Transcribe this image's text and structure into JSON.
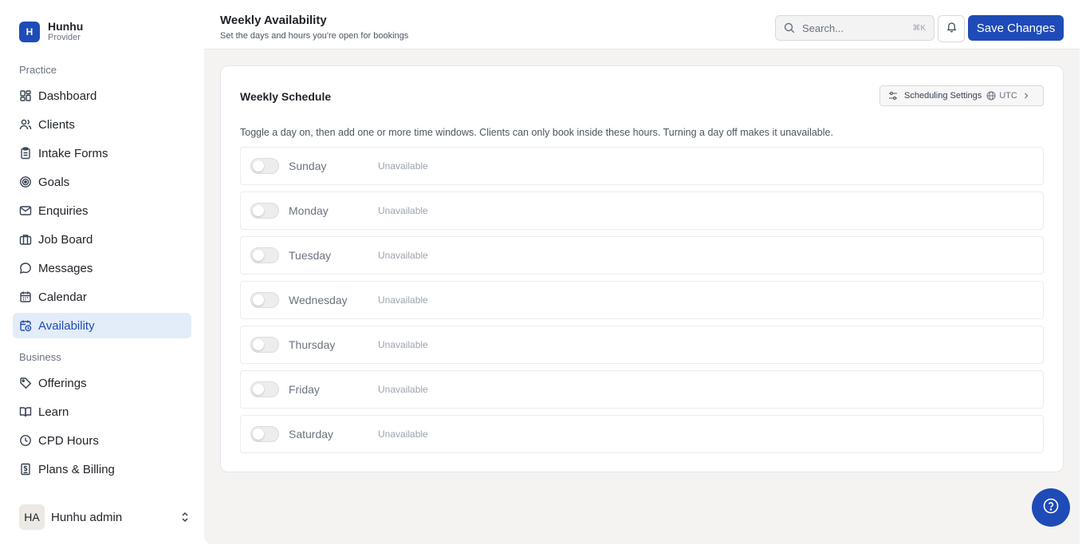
{
  "brand": {
    "logo_letter": "H",
    "name": "Hunhu",
    "subtitle": "Provider"
  },
  "sidebar": {
    "section_practice": "Practice",
    "practice_items": [
      {
        "label": "Dashboard",
        "icon": "dashboard-icon"
      },
      {
        "label": "Clients",
        "icon": "users-icon"
      },
      {
        "label": "Intake Forms",
        "icon": "clipboard-icon"
      },
      {
        "label": "Goals",
        "icon": "target-icon"
      },
      {
        "label": "Enquiries",
        "icon": "mail-icon"
      },
      {
        "label": "Job Board",
        "icon": "briefcase-icon"
      },
      {
        "label": "Messages",
        "icon": "chat-icon"
      },
      {
        "label": "Calendar",
        "icon": "calendar-icon"
      },
      {
        "label": "Availability",
        "icon": "calendar-clock-icon",
        "active": true
      }
    ],
    "section_business": "Business",
    "business_items": [
      {
        "label": "Offerings",
        "icon": "tag-icon"
      },
      {
        "label": "Learn",
        "icon": "book-icon"
      },
      {
        "label": "CPD Hours",
        "icon": "clock-icon"
      },
      {
        "label": "Plans & Billing",
        "icon": "billing-icon"
      }
    ],
    "user": {
      "initials": "HA",
      "name": "Hunhu admin"
    }
  },
  "header": {
    "title": "Weekly Availability",
    "subtitle": "Set the days and hours you're open for bookings",
    "search_placeholder": "Search...",
    "search_shortcut": "⌘K",
    "save_label": "Save Changes"
  },
  "schedule": {
    "title": "Weekly Schedule",
    "settings_label": "Scheduling Settings",
    "timezone": "UTC",
    "description": "Toggle a day on, then add one or more time windows. Clients can only book inside these hours. Turning a day off makes it unavailable.",
    "days": [
      {
        "name": "Sunday",
        "status": "Unavailable",
        "enabled": false
      },
      {
        "name": "Monday",
        "status": "Unavailable",
        "enabled": false
      },
      {
        "name": "Tuesday",
        "status": "Unavailable",
        "enabled": false
      },
      {
        "name": "Wednesday",
        "status": "Unavailable",
        "enabled": false
      },
      {
        "name": "Thursday",
        "status": "Unavailable",
        "enabled": false
      },
      {
        "name": "Friday",
        "status": "Unavailable",
        "enabled": false
      },
      {
        "name": "Saturday",
        "status": "Unavailable",
        "enabled": false
      }
    ]
  },
  "colors": {
    "accent": "#1e4bb8",
    "active_bg": "#e3ecf9",
    "main_bg": "#f4f3f1"
  }
}
